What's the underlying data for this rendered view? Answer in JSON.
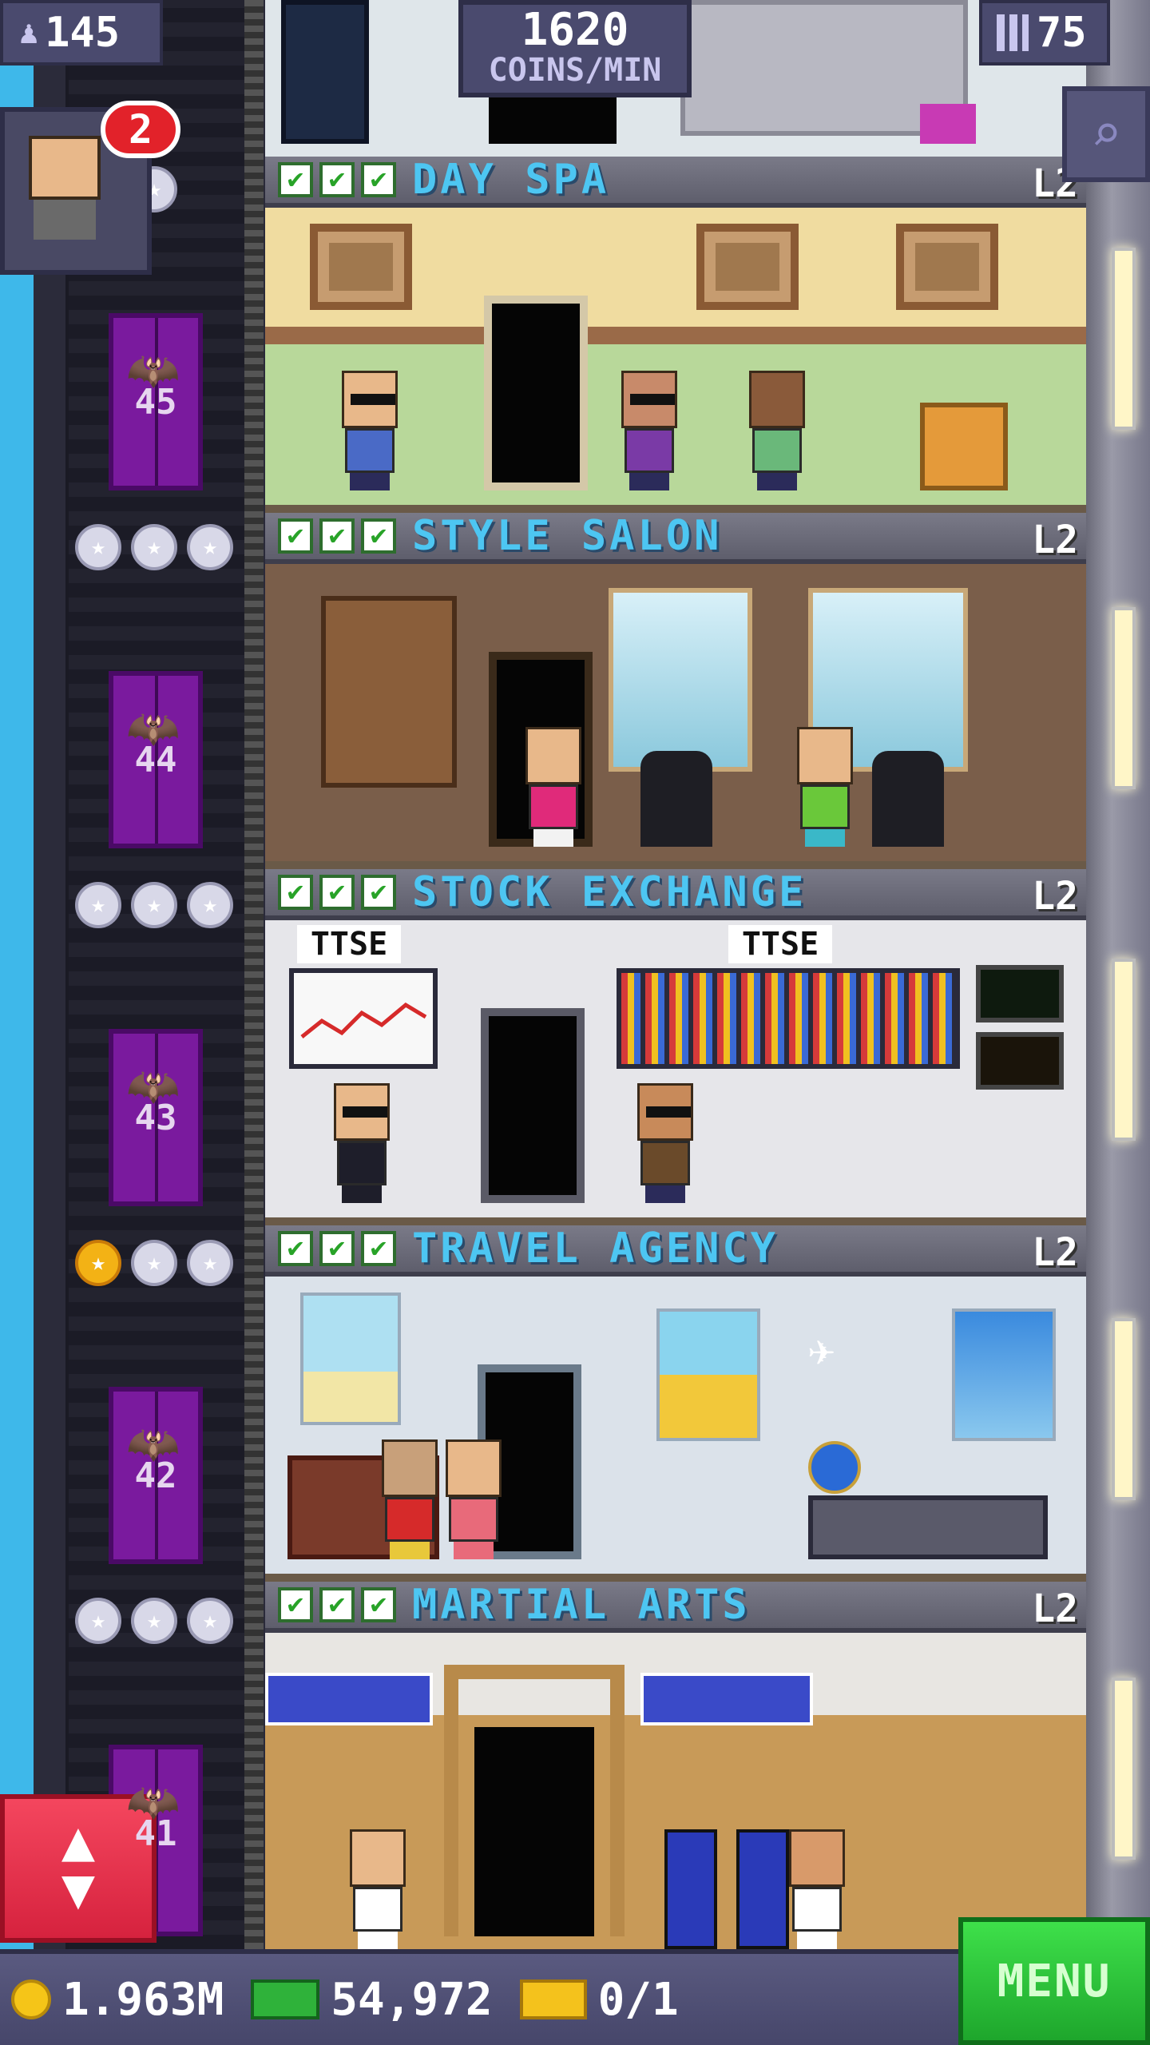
{
  "hud": {
    "population": "145",
    "coin_rate_value": "1620",
    "coin_rate_unit": "COINS/MIN",
    "floor_count": "75"
  },
  "visitor": {
    "badge_count": "2"
  },
  "elevator_floors": [
    "45",
    "44",
    "43",
    "42",
    "41"
  ],
  "floors": [
    {
      "name": "DAY SPA",
      "level": "L2"
    },
    {
      "name": "STYLE SALON",
      "level": "L2"
    },
    {
      "name": "STOCK EXCHANGE",
      "level": "L2"
    },
    {
      "name": "TRAVEL AGENCY",
      "level": "L2"
    },
    {
      "name": "MARTIAL ARTS",
      "level": "L2"
    }
  ],
  "stock_signs": [
    "TTSE",
    "TTSE"
  ],
  "bottom_bar": {
    "coins": "1.963M",
    "tower_bux": "54,972",
    "tickets": "0/1",
    "menu_label": "MENU"
  },
  "colors": {
    "floor_name": "#4dc6f2",
    "elevator": "#7a1a9e",
    "menu_button": "#2fc23c",
    "elevator_button": "#e83450"
  }
}
